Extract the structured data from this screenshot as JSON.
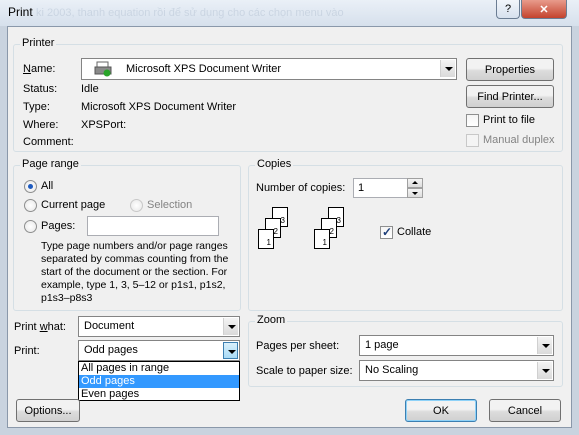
{
  "window": {
    "title": "Print",
    "help": "?",
    "close": "✕",
    "background_text": "ki 2003, thanh equation rồi để sử dụng cho các chọn menu vào"
  },
  "printer": {
    "group": "Printer",
    "name_label": "Name:",
    "name_value": "Microsoft XPS Document Writer",
    "status_label": "Status:",
    "status_value": "Idle",
    "type_label": "Type:",
    "type_value": "Microsoft XPS Document Writer",
    "where_label": "Where:",
    "where_value": "XPSPort:",
    "comment_label": "Comment:",
    "comment_value": "",
    "properties": "Properties",
    "find_printer": "Find Printer...",
    "print_to_file": "Print to file",
    "manual_duplex": "Manual duplex"
  },
  "page_range": {
    "group": "Page range",
    "all": "All",
    "current": "Current page",
    "selection": "Selection",
    "pages": "Pages:",
    "pages_value": "",
    "hint": "Type page numbers and/or page ranges separated by commas counting from the start of the document or the section. For example, type 1, 3, 5–12 or p1s1, p1s2, p1s3–p8s3"
  },
  "copies": {
    "group": "Copies",
    "label": "Number of copies:",
    "value": "1",
    "collate": "Collate",
    "pages": [
      "1",
      "2",
      "3"
    ]
  },
  "print_what": {
    "label": "Print what:",
    "value": "Document"
  },
  "print": {
    "label": "Print:",
    "value": "Odd pages",
    "options": [
      "All pages in range",
      "Odd pages",
      "Even pages"
    ]
  },
  "zoom": {
    "group": "Zoom",
    "pps_label": "Pages per sheet:",
    "pps_value": "1 page",
    "scale_label": "Scale to paper size:",
    "scale_value": "No Scaling"
  },
  "buttons": {
    "options": "Options...",
    "ok": "OK",
    "cancel": "Cancel"
  },
  "colors": {
    "selected": "#3399ff",
    "client": "#f0f0f0",
    "close": "#c4432d"
  }
}
